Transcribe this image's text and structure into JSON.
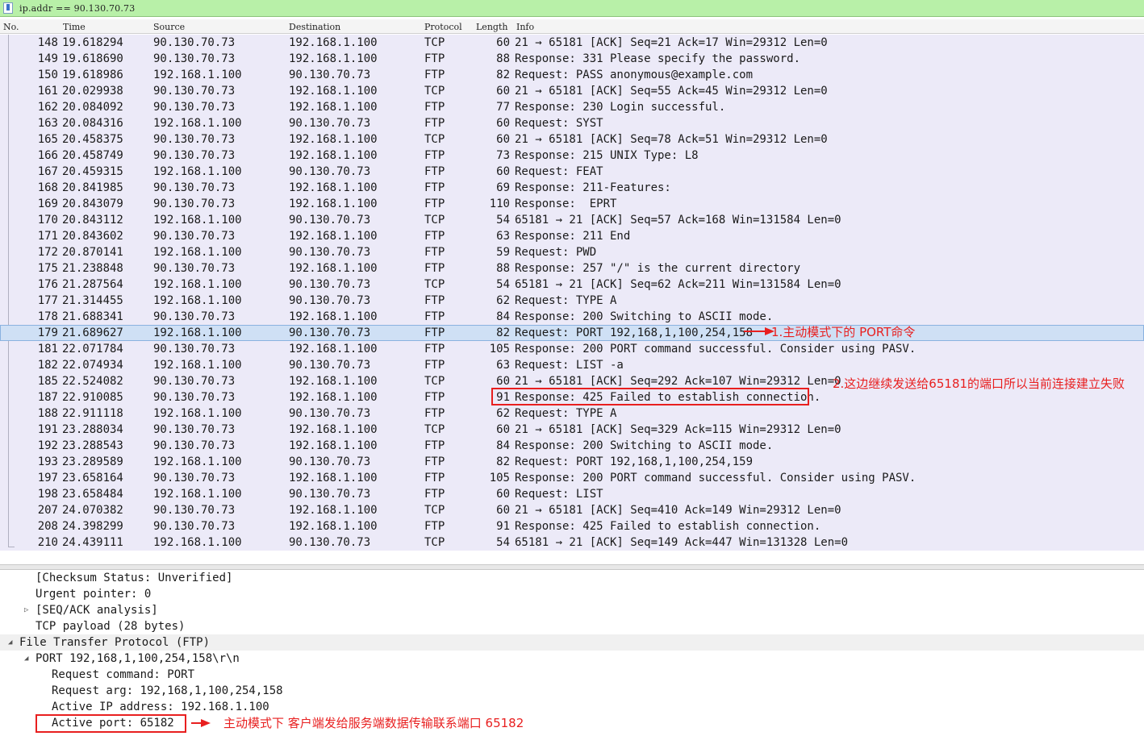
{
  "filter": {
    "text": "ip.addr == 90.130.70.73"
  },
  "columns": {
    "no": "No.",
    "time": "Time",
    "source": "Source",
    "destination": "Destination",
    "protocol": "Protocol",
    "length": "Length",
    "info": "Info"
  },
  "packets": [
    {
      "no": "148",
      "time": "19.618294",
      "src": "90.130.70.73",
      "dst": "192.168.1.100",
      "proto": "TCP",
      "len": "60",
      "info": "21 → 65181 [ACK] Seq=21 Ack=17 Win=29312 Len=0"
    },
    {
      "no": "149",
      "time": "19.618690",
      "src": "90.130.70.73",
      "dst": "192.168.1.100",
      "proto": "FTP",
      "len": "88",
      "info": "Response: 331 Please specify the password."
    },
    {
      "no": "150",
      "time": "19.618986",
      "src": "192.168.1.100",
      "dst": "90.130.70.73",
      "proto": "FTP",
      "len": "82",
      "info": "Request: PASS anonymous@example.com"
    },
    {
      "no": "161",
      "time": "20.029938",
      "src": "90.130.70.73",
      "dst": "192.168.1.100",
      "proto": "TCP",
      "len": "60",
      "info": "21 → 65181 [ACK] Seq=55 Ack=45 Win=29312 Len=0"
    },
    {
      "no": "162",
      "time": "20.084092",
      "src": "90.130.70.73",
      "dst": "192.168.1.100",
      "proto": "FTP",
      "len": "77",
      "info": "Response: 230 Login successful."
    },
    {
      "no": "163",
      "time": "20.084316",
      "src": "192.168.1.100",
      "dst": "90.130.70.73",
      "proto": "FTP",
      "len": "60",
      "info": "Request: SYST"
    },
    {
      "no": "165",
      "time": "20.458375",
      "src": "90.130.70.73",
      "dst": "192.168.1.100",
      "proto": "TCP",
      "len": "60",
      "info": "21 → 65181 [ACK] Seq=78 Ack=51 Win=29312 Len=0"
    },
    {
      "no": "166",
      "time": "20.458749",
      "src": "90.130.70.73",
      "dst": "192.168.1.100",
      "proto": "FTP",
      "len": "73",
      "info": "Response: 215 UNIX Type: L8"
    },
    {
      "no": "167",
      "time": "20.459315",
      "src": "192.168.1.100",
      "dst": "90.130.70.73",
      "proto": "FTP",
      "len": "60",
      "info": "Request: FEAT"
    },
    {
      "no": "168",
      "time": "20.841985",
      "src": "90.130.70.73",
      "dst": "192.168.1.100",
      "proto": "FTP",
      "len": "69",
      "info": "Response: 211-Features:"
    },
    {
      "no": "169",
      "time": "20.843079",
      "src": "90.130.70.73",
      "dst": "192.168.1.100",
      "proto": "FTP",
      "len": "110",
      "info": "Response:  EPRT"
    },
    {
      "no": "170",
      "time": "20.843112",
      "src": "192.168.1.100",
      "dst": "90.130.70.73",
      "proto": "TCP",
      "len": "54",
      "info": "65181 → 21 [ACK] Seq=57 Ack=168 Win=131584 Len=0"
    },
    {
      "no": "171",
      "time": "20.843602",
      "src": "90.130.70.73",
      "dst": "192.168.1.100",
      "proto": "FTP",
      "len": "63",
      "info": "Response: 211 End"
    },
    {
      "no": "172",
      "time": "20.870141",
      "src": "192.168.1.100",
      "dst": "90.130.70.73",
      "proto": "FTP",
      "len": "59",
      "info": "Request: PWD"
    },
    {
      "no": "175",
      "time": "21.238848",
      "src": "90.130.70.73",
      "dst": "192.168.1.100",
      "proto": "FTP",
      "len": "88",
      "info": "Response: 257 \"/\" is the current directory"
    },
    {
      "no": "176",
      "time": "21.287564",
      "src": "192.168.1.100",
      "dst": "90.130.70.73",
      "proto": "TCP",
      "len": "54",
      "info": "65181 → 21 [ACK] Seq=62 Ack=211 Win=131584 Len=0"
    },
    {
      "no": "177",
      "time": "21.314455",
      "src": "192.168.1.100",
      "dst": "90.130.70.73",
      "proto": "FTP",
      "len": "62",
      "info": "Request: TYPE A"
    },
    {
      "no": "178",
      "time": "21.688341",
      "src": "90.130.70.73",
      "dst": "192.168.1.100",
      "proto": "FTP",
      "len": "84",
      "info": "Response: 200 Switching to ASCII mode."
    },
    {
      "no": "179",
      "time": "21.689627",
      "src": "192.168.1.100",
      "dst": "90.130.70.73",
      "proto": "FTP",
      "len": "82",
      "info": "Request: PORT 192,168,1,100,254,158",
      "selected": true
    },
    {
      "no": "181",
      "time": "22.071784",
      "src": "90.130.70.73",
      "dst": "192.168.1.100",
      "proto": "FTP",
      "len": "105",
      "info": "Response: 200 PORT command successful. Consider using PASV."
    },
    {
      "no": "182",
      "time": "22.074934",
      "src": "192.168.1.100",
      "dst": "90.130.70.73",
      "proto": "FTP",
      "len": "63",
      "info": "Request: LIST -a"
    },
    {
      "no": "185",
      "time": "22.524082",
      "src": "90.130.70.73",
      "dst": "192.168.1.100",
      "proto": "TCP",
      "len": "60",
      "info": "21 → 65181 [ACK] Seq=292 Ack=107 Win=29312 Len=0"
    },
    {
      "no": "187",
      "time": "22.910085",
      "src": "90.130.70.73",
      "dst": "192.168.1.100",
      "proto": "FTP",
      "len": "91",
      "info": "Response: 425 Failed to establish connection."
    },
    {
      "no": "188",
      "time": "22.911118",
      "src": "192.168.1.100",
      "dst": "90.130.70.73",
      "proto": "FTP",
      "len": "62",
      "info": "Request: TYPE A"
    },
    {
      "no": "191",
      "time": "23.288034",
      "src": "90.130.70.73",
      "dst": "192.168.1.100",
      "proto": "TCP",
      "len": "60",
      "info": "21 → 65181 [ACK] Seq=329 Ack=115 Win=29312 Len=0"
    },
    {
      "no": "192",
      "time": "23.288543",
      "src": "90.130.70.73",
      "dst": "192.168.1.100",
      "proto": "FTP",
      "len": "84",
      "info": "Response: 200 Switching to ASCII mode."
    },
    {
      "no": "193",
      "time": "23.289589",
      "src": "192.168.1.100",
      "dst": "90.130.70.73",
      "proto": "FTP",
      "len": "82",
      "info": "Request: PORT 192,168,1,100,254,159"
    },
    {
      "no": "197",
      "time": "23.658164",
      "src": "90.130.70.73",
      "dst": "192.168.1.100",
      "proto": "FTP",
      "len": "105",
      "info": "Response: 200 PORT command successful. Consider using PASV."
    },
    {
      "no": "198",
      "time": "23.658484",
      "src": "192.168.1.100",
      "dst": "90.130.70.73",
      "proto": "FTP",
      "len": "60",
      "info": "Request: LIST"
    },
    {
      "no": "207",
      "time": "24.070382",
      "src": "90.130.70.73",
      "dst": "192.168.1.100",
      "proto": "TCP",
      "len": "60",
      "info": "21 → 65181 [ACK] Seq=410 Ack=149 Win=29312 Len=0"
    },
    {
      "no": "208",
      "time": "24.398299",
      "src": "90.130.70.73",
      "dst": "192.168.1.100",
      "proto": "FTP",
      "len": "91",
      "info": "Response: 425 Failed to establish connection."
    },
    {
      "no": "210",
      "time": "24.439111",
      "src": "192.168.1.100",
      "dst": "90.130.70.73",
      "proto": "TCP",
      "len": "54",
      "info": "65181 → 21 [ACK] Seq=149 Ack=447 Win=131328 Len=0"
    }
  ],
  "details": [
    {
      "text": "[Checksum Status: Unverified]",
      "indent": 44,
      "tri": ""
    },
    {
      "text": "Urgent pointer: 0",
      "indent": 44,
      "tri": ""
    },
    {
      "text": "[SEQ/ACK analysis]",
      "indent": 44,
      "tri": "▷"
    },
    {
      "text": "TCP payload (28 bytes)",
      "indent": 44,
      "tri": ""
    },
    {
      "text": "File Transfer Protocol (FTP)",
      "indent": 24,
      "tri": "◢",
      "highlight": true
    },
    {
      "text": "PORT 192,168,1,100,254,158\\r\\n",
      "indent": 44,
      "tri": "◢"
    },
    {
      "text": "Request command: PORT",
      "indent": 64,
      "tri": ""
    },
    {
      "text": "Request arg: 192,168,1,100,254,158",
      "indent": 64,
      "tri": ""
    },
    {
      "text": "Active IP address: 192.168.1.100",
      "indent": 64,
      "tri": ""
    },
    {
      "text": "Active port: 65182",
      "indent": 64,
      "tri": ""
    }
  ],
  "annotations": {
    "a1": "1.主动模式下的 PORT命令",
    "a2": "2.这边继续发送给65181的端口所以当前连接建立失败",
    "a3": "主动模式下 客户端发给服务端数据传输联系端口 65182"
  },
  "colors": {
    "annotation": "#e81f1f",
    "filter_bg": "#b8f0a8",
    "list_bg": "#eceaf8",
    "selected_bg": "#cfe0f5"
  }
}
